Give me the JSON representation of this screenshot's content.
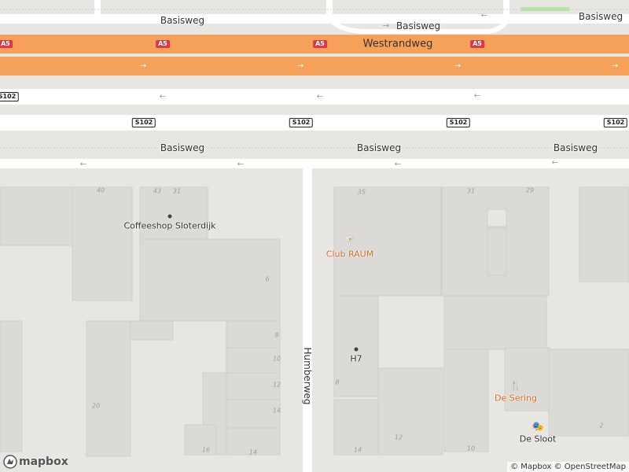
{
  "roads": {
    "basisweg": "Basisweg",
    "westrandweg": "Westrandweg",
    "humberweg": "Humberweg"
  },
  "shields": {
    "a5": "A5",
    "s102": "S102"
  },
  "pois": {
    "coffeeshop": "Coffeeshop Sloterdijk",
    "club": "Club RAUM",
    "h7": "H7",
    "de_sering": "De Sering",
    "de_sloot": "De Sloot"
  },
  "house_numbers": [
    "40",
    "43",
    "31",
    "35",
    "31",
    "29",
    "6",
    "8",
    "10",
    "12",
    "14",
    "16",
    "14",
    "20",
    "8",
    "12",
    "14",
    "10",
    "2"
  ],
  "attribution": {
    "mapbox": "© Mapbox",
    "osm": "© OpenStreetMap"
  },
  "logo": "mapbox",
  "colors": {
    "highway": "#f6a15a",
    "road": "#ffffff",
    "building": "#dcdad6",
    "poi_orange": "#d4691c"
  }
}
